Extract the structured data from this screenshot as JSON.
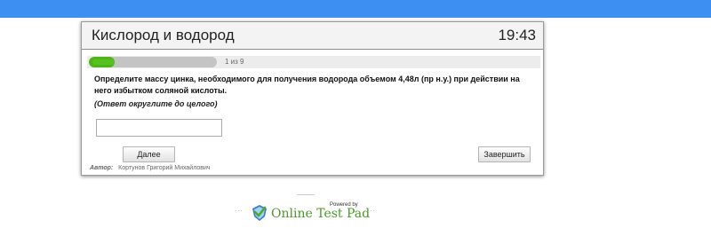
{
  "test": {
    "title": "Кислород и водород",
    "timer": "19:43"
  },
  "progress": {
    "text": "1 из 9",
    "current": 1,
    "total": 9
  },
  "question": {
    "text": "Определите массу цинка, необходимого для получения водорода объемом 4,48л (пр н.у.) при действии на него избытком соляной кислоты.",
    "hint": "(Ответ округлите до целого)"
  },
  "answer": {
    "value": "",
    "placeholder": ""
  },
  "buttons": {
    "next_label": "Далее",
    "finish_label": "Завершить"
  },
  "author": {
    "label": "Автор:",
    "name": "Кортунов Григорий Михайлович"
  },
  "footer": {
    "powered_by": "Powered by",
    "brand": "Online Test Pad",
    "dots_left": "...",
    "dots_right": "..."
  },
  "colors": {
    "top_bar": "#3d8ff2",
    "progress_fill": "#55c21d",
    "brand_green": "#4a9a26"
  },
  "icons": {
    "logo": "checkmark-shield-icon"
  }
}
